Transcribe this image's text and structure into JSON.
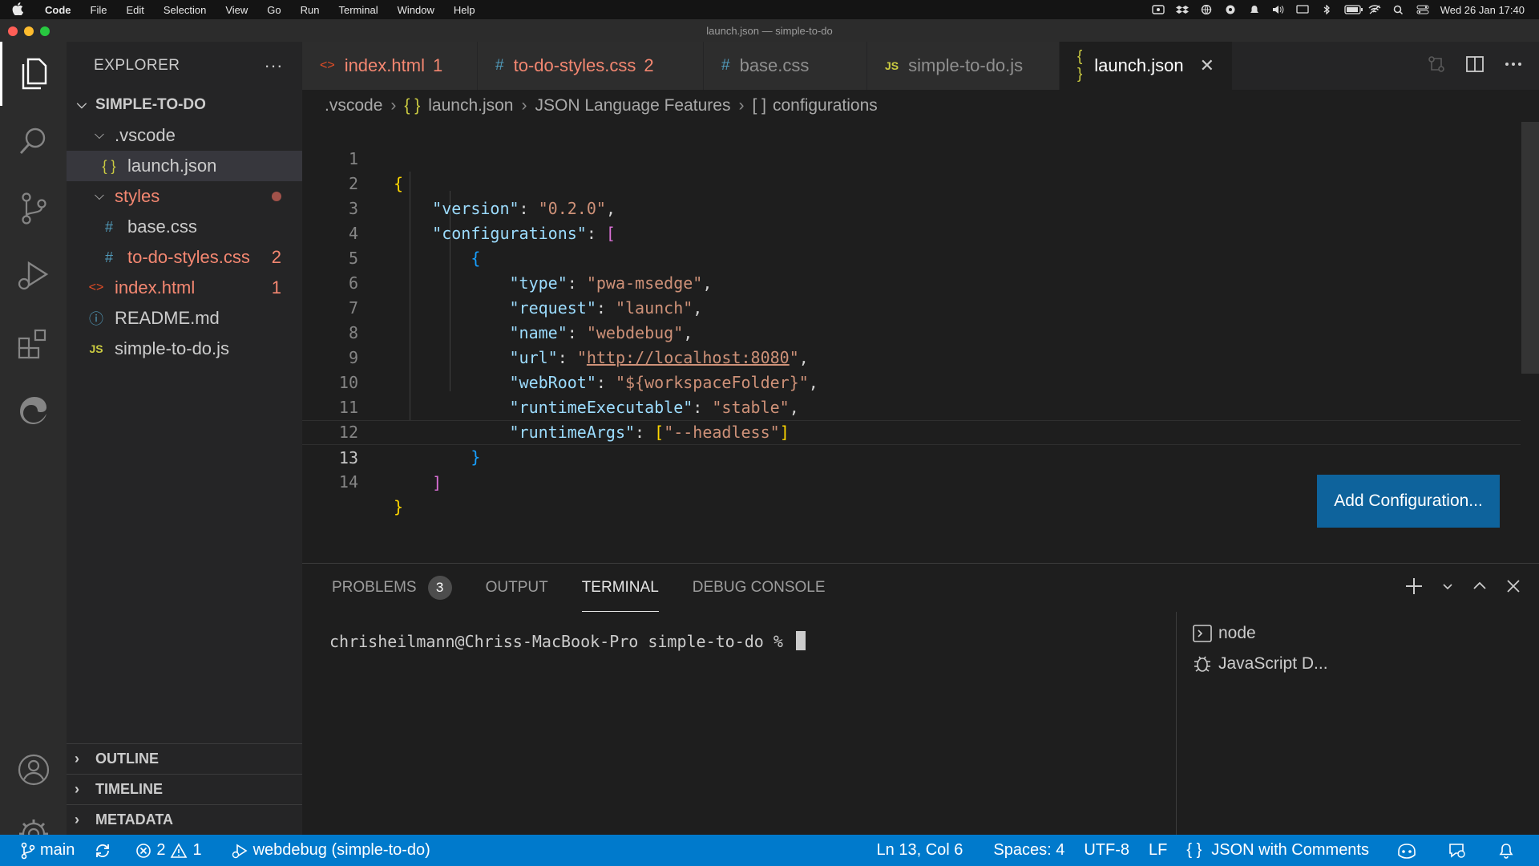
{
  "menubar": {
    "app": "Code",
    "items": [
      "File",
      "Edit",
      "Selection",
      "View",
      "Go",
      "Run",
      "Terminal",
      "Window",
      "Help"
    ],
    "clock": "Wed 26 Jan  17:40"
  },
  "window": {
    "title": "launch.json — simple-to-do"
  },
  "explorer": {
    "title": "EXPLORER",
    "more": "···",
    "folder": "SIMPLE-TO-DO",
    "items": [
      {
        "label": ".vscode"
      },
      {
        "label": "launch.json"
      },
      {
        "label": "styles"
      },
      {
        "label": "base.css"
      },
      {
        "label": "to-do-styles.css",
        "badge": "2"
      },
      {
        "label": "index.html",
        "badge": "1"
      },
      {
        "label": "README.md"
      },
      {
        "label": "simple-to-do.js"
      }
    ],
    "sections": [
      "OUTLINE",
      "TIMELINE",
      "METADATA"
    ]
  },
  "tabs": [
    {
      "label": "index.html",
      "icon": "<>",
      "count": "1"
    },
    {
      "label": "to-do-styles.css",
      "icon": "#",
      "count": "2"
    },
    {
      "label": "base.css",
      "icon": "#"
    },
    {
      "label": "simple-to-do.js",
      "icon": "JS"
    },
    {
      "label": "launch.json",
      "icon": "{ }"
    }
  ],
  "breadcrumb": [
    ".vscode",
    "launch.json",
    "JSON Language Features",
    "configurations"
  ],
  "editor": {
    "line_numbers": [
      "1",
      "2",
      "3",
      "4",
      "5",
      "6",
      "7",
      "8",
      "9",
      "10",
      "11",
      "12",
      "13",
      "14"
    ],
    "code": {
      "version_key": "\"version\"",
      "version_val": "\"0.2.0\"",
      "configurations_key": "\"configurations\"",
      "type_key": "\"type\"",
      "type_val": "\"pwa-msedge\"",
      "request_key": "\"request\"",
      "request_val": "\"launch\"",
      "name_key": "\"name\"",
      "name_val": "\"webdebug\"",
      "url_key": "\"url\"",
      "url_quote": "\"",
      "url_val": "http://localhost:8080",
      "webroot_key": "\"webRoot\"",
      "webroot_val": "\"${workspaceFolder}\"",
      "runtime_exec_key": "\"runtimeExecutable\"",
      "runtime_exec_val": "\"stable\"",
      "runtime_args_key": "\"runtimeArgs\"",
      "runtime_args_val": "\"--headless\""
    },
    "add_configuration": "Add Configuration..."
  },
  "panel": {
    "tabs": [
      "PROBLEMS",
      "OUTPUT",
      "TERMINAL",
      "DEBUG CONSOLE"
    ],
    "problems_count": "3",
    "terminal_prompt": "chrisheilmann@Chriss-MacBook-Pro simple-to-do % ",
    "terminals": [
      "node",
      "JavaScript D..."
    ]
  },
  "status": {
    "branch": "main",
    "errors": "2",
    "warnings": "1",
    "debug": "webdebug (simple-to-do)",
    "position": "Ln 13, Col 6",
    "spaces": "Spaces: 4",
    "encoding": "UTF-8",
    "eol": "LF",
    "language": "JSON with Comments"
  },
  "colors": {
    "accent": "#007acc",
    "button": "#0e639c",
    "modified": "#f48771"
  }
}
